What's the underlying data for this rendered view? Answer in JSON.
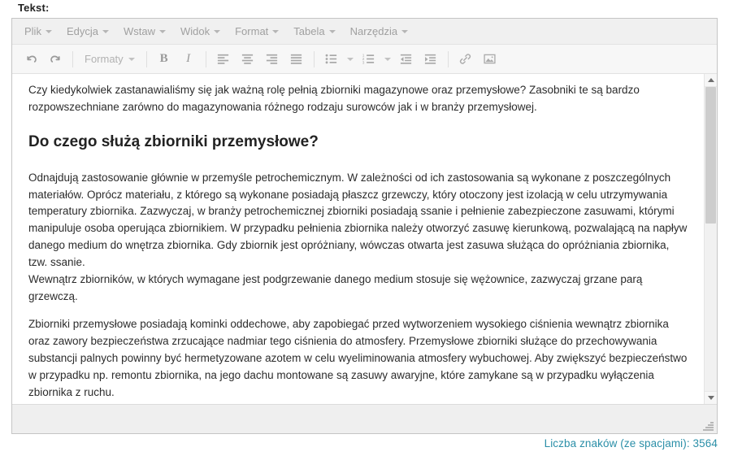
{
  "field_label": "Tekst:",
  "accent_color": "#2b8fa8",
  "menubar": {
    "items": [
      {
        "label": "Plik"
      },
      {
        "label": "Edycja"
      },
      {
        "label": "Wstaw"
      },
      {
        "label": "Widok"
      },
      {
        "label": "Format"
      },
      {
        "label": "Tabela"
      },
      {
        "label": "Narzędzia"
      }
    ]
  },
  "toolbar": {
    "undo": "undo-icon",
    "redo": "redo-icon",
    "formats_label": "Formaty",
    "bold": "B",
    "italic": "I",
    "align_left": "align-left-icon",
    "align_center": "align-center-icon",
    "align_right": "align-right-icon",
    "align_justify": "align-justify-icon",
    "bullet_list": "bullet-list-icon",
    "numbered_list": "numbered-list-icon",
    "outdent": "outdent-icon",
    "indent": "indent-icon",
    "link": "link-icon",
    "image": "image-icon"
  },
  "document": {
    "paragraph_1": "Czy kiedykolwiek zastanawialiśmy się jak ważną rolę pełnią zbiorniki magazynowe oraz przemysłowe? Zasobniki te są bardzo rozpowszechniane zarówno do magazynowania różnego rodzaju surowców jak i w branży przemysłowej.",
    "heading_1": "Do czego służą zbiorniki przemysłowe?",
    "paragraph_2": "Odnajdują zastosowanie głównie w przemyśle petrochemicznym. W zależności od ich zastosowania są wykonane z poszczególnych materiałów. Oprócz materiału, z którego są wykonane posiadają płaszcz grzewczy, który otoczony jest izolacją w celu utrzymywania temperatury zbiornika. Zazwyczaj, w branży petrochemicznej zbiorniki posiadają ssanie i pełnienie zabezpieczone zasuwami, którymi manipuluje osoba operująca zbiornikiem. W przypadku pełnienia zbiornika należy otworzyć zasuwę kierunkową, pozwalającą na napływ danego medium do wnętrza zbiornika. Gdy zbiornik jest opróżniany, wówczas otwarta jest zasuwa służąca do opróżniania zbiornika, tzw. ssanie.",
    "paragraph_3": "Wewnątrz zbiorników, w których wymagane jest podgrzewanie danego medium stosuje się wężownice, zazwyczaj grzane parą grzewczą.",
    "paragraph_4": "Zbiorniki przemysłowe posiadają kominki oddechowe, aby zapobiegać przed wytworzeniem wysokiego ciśnienia wewnątrz zbiornika oraz zawory bezpieczeństwa zrzucające nadmiar tego ciśnienia do atmosfery. Przemysłowe zbiorniki służące do przechowywania substancji palnych powinny być hermetyzowane azotem w celu wyeliminowania atmosfery wybuchowej. Aby zwiększyć bezpieczeństwo w przypadku np. remontu zbiornika, na jego dachu montowane są zasuwy awaryjne, które zamykane są w przypadku wyłączenia zbiornika z ruchu."
  },
  "footer": {
    "char_count_text": "Liczba znaków (ze spacjami): 3564",
    "char_count_value": 3564
  }
}
